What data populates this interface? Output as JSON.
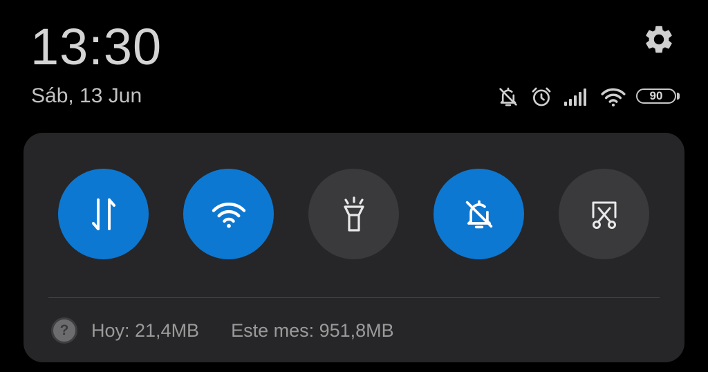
{
  "status": {
    "time": "13:30",
    "date": "Sáb, 13 Jun",
    "battery_level": "90",
    "icons": [
      "bell-off-icon",
      "alarm-clock-icon",
      "signal-icon",
      "wifi-icon",
      "battery-icon"
    ]
  },
  "quick_tiles": [
    {
      "id": "mobile-data",
      "icon": "data-arrows-icon",
      "active": true
    },
    {
      "id": "wifi",
      "icon": "wifi-icon",
      "active": true
    },
    {
      "id": "flashlight",
      "icon": "flashlight-icon",
      "active": false
    },
    {
      "id": "silent",
      "icon": "bell-off-icon",
      "active": true
    },
    {
      "id": "screenshot",
      "icon": "scissors-icon",
      "active": false
    }
  ],
  "data_usage": {
    "help_glyph": "?",
    "today": "Hoy: 21,4MB",
    "month": "Este mes: 951,8MB"
  },
  "colors": {
    "active_tile": "#0d78d2",
    "inactive_tile": "#3a3a3c",
    "panel": "#262628",
    "background": "#000000"
  }
}
